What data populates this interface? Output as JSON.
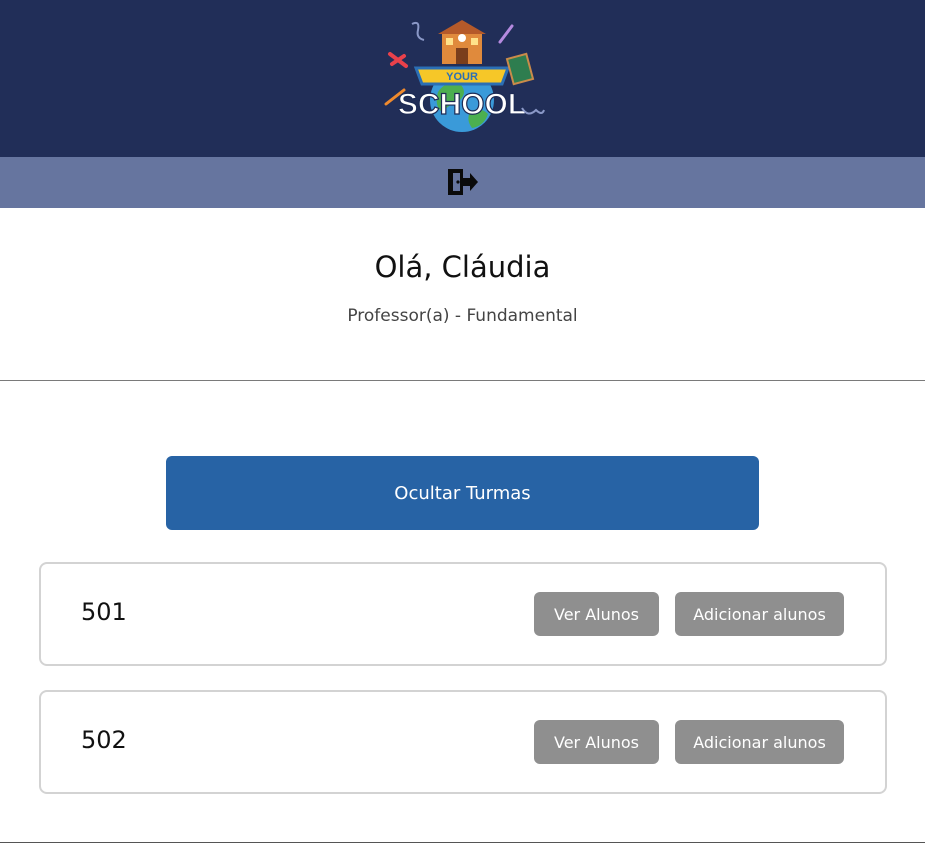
{
  "header": {
    "logo_text_top": "YOUR",
    "logo_text_main": "SCHOOL",
    "background_color": "#212e58"
  },
  "navbar": {
    "logout_icon": "logout-icon",
    "background_color": "#66759f"
  },
  "profile": {
    "greeting": "Olá, Cláudia",
    "role": "Professor(a) - Fundamental"
  },
  "toggle": {
    "label": "Ocultar Turmas",
    "color": "#2763a5"
  },
  "classes": [
    {
      "name": "501",
      "view_label": "Ver Alunos",
      "add_label": "Adicionar alunos"
    },
    {
      "name": "502",
      "view_label": "Ver Alunos",
      "add_label": "Adicionar alunos"
    }
  ],
  "button_color": "#8f8f8f"
}
